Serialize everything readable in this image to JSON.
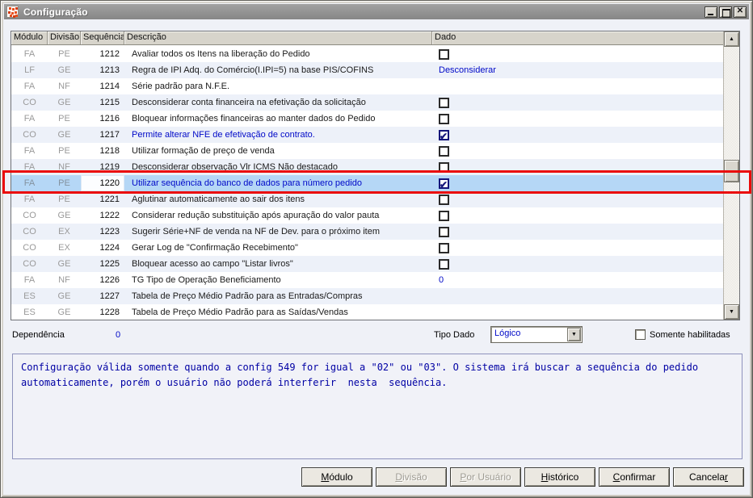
{
  "window": {
    "title": "Configuração"
  },
  "grid": {
    "columns": [
      "Módulo",
      "Divisão",
      "Sequência",
      "Descrição",
      "Dado"
    ],
    "rows": [
      {
        "modulo": "FA",
        "divisao": "PE",
        "seq": "1212",
        "desc": "Avaliar todos os Itens na liberação do Pedido",
        "dado": {
          "type": "checkbox",
          "checked": false
        }
      },
      {
        "modulo": "LF",
        "divisao": "GE",
        "seq": "1213",
        "desc": "Regra de IPI Adq. do Comércio(I.IPI=5) na base PIS/COFINS",
        "dado": {
          "type": "text",
          "value": "Desconsiderar"
        }
      },
      {
        "modulo": "FA",
        "divisao": "NF",
        "seq": "1214",
        "desc": "Série padrão para N.F.E.",
        "dado": {
          "type": "none"
        }
      },
      {
        "modulo": "CO",
        "divisao": "GE",
        "seq": "1215",
        "desc": "Desconsiderar conta financeira na efetivação da solicitação",
        "dado": {
          "type": "checkbox",
          "checked": false
        }
      },
      {
        "modulo": "FA",
        "divisao": "PE",
        "seq": "1216",
        "desc": "Bloquear informações financeiras ao manter dados do Pedido",
        "dado": {
          "type": "checkbox",
          "checked": false
        }
      },
      {
        "modulo": "CO",
        "divisao": "GE",
        "seq": "1217",
        "desc": "Permite alterar NFE de efetivação de contrato.",
        "desc_style": "link",
        "dado": {
          "type": "checkbox",
          "checked": true
        }
      },
      {
        "modulo": "FA",
        "divisao": "PE",
        "seq": "1218",
        "desc": "Utilizar formação de preço de venda",
        "dado": {
          "type": "checkbox",
          "checked": false
        }
      },
      {
        "modulo": "FA",
        "divisao": "NF",
        "seq": "1219",
        "desc": "Desconsiderar observação Vlr ICMS Não destacado",
        "dado": {
          "type": "checkbox",
          "checked": false
        }
      },
      {
        "modulo": "FA",
        "divisao": "PE",
        "seq": "1220",
        "desc": "Utilizar sequência do banco de dados para  número pedido",
        "desc_style": "link",
        "selected": true,
        "seq_editor": true,
        "dado": {
          "type": "checkbox",
          "checked": true
        }
      },
      {
        "modulo": "FA",
        "divisao": "PE",
        "seq": "1221",
        "desc": "Aglutinar automaticamente ao sair dos itens",
        "dado": {
          "type": "checkbox",
          "checked": false
        }
      },
      {
        "modulo": "CO",
        "divisao": "GE",
        "seq": "1222",
        "desc": "Considerar redução substituição após apuração do valor pauta",
        "dado": {
          "type": "checkbox",
          "checked": false
        }
      },
      {
        "modulo": "CO",
        "divisao": "EX",
        "seq": "1223",
        "desc": "Sugerir Série+NF de venda na NF de Dev. para o próximo item",
        "dado": {
          "type": "checkbox",
          "checked": false
        }
      },
      {
        "modulo": "CO",
        "divisao": "EX",
        "seq": "1224",
        "desc": "Gerar Log de \"Confirmação Recebimento\"",
        "dado": {
          "type": "checkbox",
          "checked": false
        }
      },
      {
        "modulo": "CO",
        "divisao": "GE",
        "seq": "1225",
        "desc": "Bloquear acesso ao campo \"Listar livros\"",
        "dado": {
          "type": "checkbox",
          "checked": false
        }
      },
      {
        "modulo": "FA",
        "divisao": "NF",
        "seq": "1226",
        "desc": "TG Tipo de Operação Beneficiamento",
        "dado": {
          "type": "text",
          "value": "0"
        }
      },
      {
        "modulo": "ES",
        "divisao": "GE",
        "seq": "1227",
        "desc": "Tabela de Preço Médio Padrão para as Entradas/Compras",
        "dado": {
          "type": "none"
        }
      },
      {
        "modulo": "ES",
        "divisao": "GE",
        "seq": "1228",
        "desc": "Tabela de Preço Médio Padrão para as Saídas/Vendas",
        "dado": {
          "type": "none"
        }
      }
    ]
  },
  "footer": {
    "dependencia_label": "Dependência",
    "dependencia_value": "0",
    "tipo_dado_label": "Tipo Dado",
    "tipo_dado_value": "Lógico",
    "somente_habilitadas_label": "Somente habilitadas"
  },
  "memo": {
    "text": "Configuração válida somente quando a config 549 for igual a \"02\" ou \"03\". O sistema irá buscar a sequência do pedido\nautomaticamente, porém o usuário não poderá interferir  nesta  sequência."
  },
  "buttons": [
    {
      "label": "Módulo",
      "accel": 0,
      "enabled": true
    },
    {
      "label": "Divisão",
      "accel": 0,
      "enabled": false
    },
    {
      "label": "Por Usuário",
      "accel": 0,
      "enabled": false
    },
    {
      "label": "Histórico",
      "accel": 0,
      "enabled": true
    },
    {
      "label": "Confirmar",
      "accel": 0,
      "enabled": true
    },
    {
      "label": "Cancelar",
      "accel": 7,
      "enabled": true
    }
  ],
  "colors": {
    "selected_row": "#b5d7f6",
    "annotation_red": "#ea0a0a",
    "link_blue": "#0009c8",
    "titlebar_gray": "#8e8e8e"
  }
}
